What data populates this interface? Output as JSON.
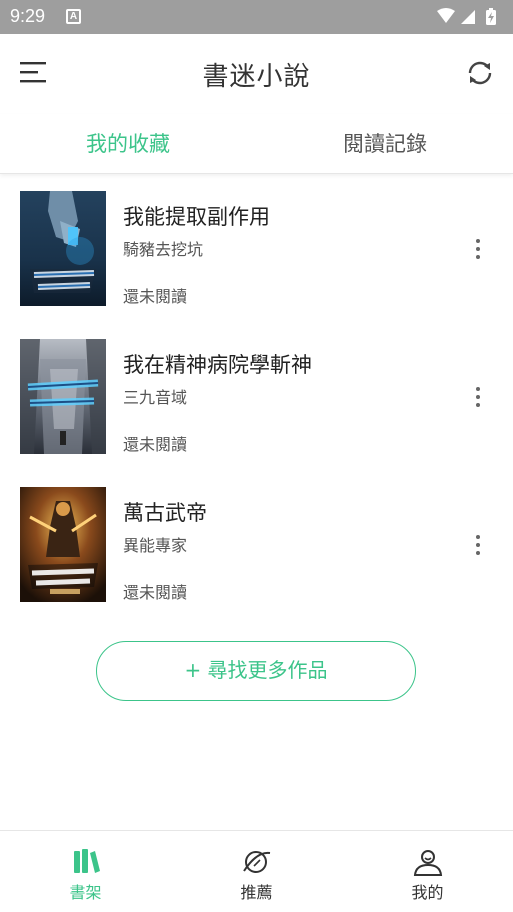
{
  "status_bar": {
    "time": "9:29",
    "notification_letter": "A"
  },
  "app_bar": {
    "title": "書迷小說",
    "menu_icon": "menu-icon",
    "refresh_icon": "refresh-icon"
  },
  "tabs": [
    {
      "label": "我的收藏",
      "active": true
    },
    {
      "label": "閱讀記錄",
      "active": false
    }
  ],
  "books": [
    {
      "title": "我能提取副作用",
      "author": "騎豬去挖坑",
      "progress": "還未閱讀"
    },
    {
      "title": "我在精神病院學斬神",
      "author": "三九音域",
      "progress": "還未閱讀"
    },
    {
      "title": "萬古武帝",
      "author": "異能專家",
      "progress": "還未閱讀"
    }
  ],
  "find_more": {
    "label": "+ 尋找更多作品"
  },
  "bottom_nav": [
    {
      "label": "書架",
      "icon": "bookshelf-icon",
      "active": true
    },
    {
      "label": "推薦",
      "icon": "planet-icon",
      "active": false
    },
    {
      "label": "我的",
      "icon": "user-icon",
      "active": false
    }
  ],
  "colors": {
    "accent": "#3cc48a",
    "status_bar": "#9e9e9e"
  }
}
